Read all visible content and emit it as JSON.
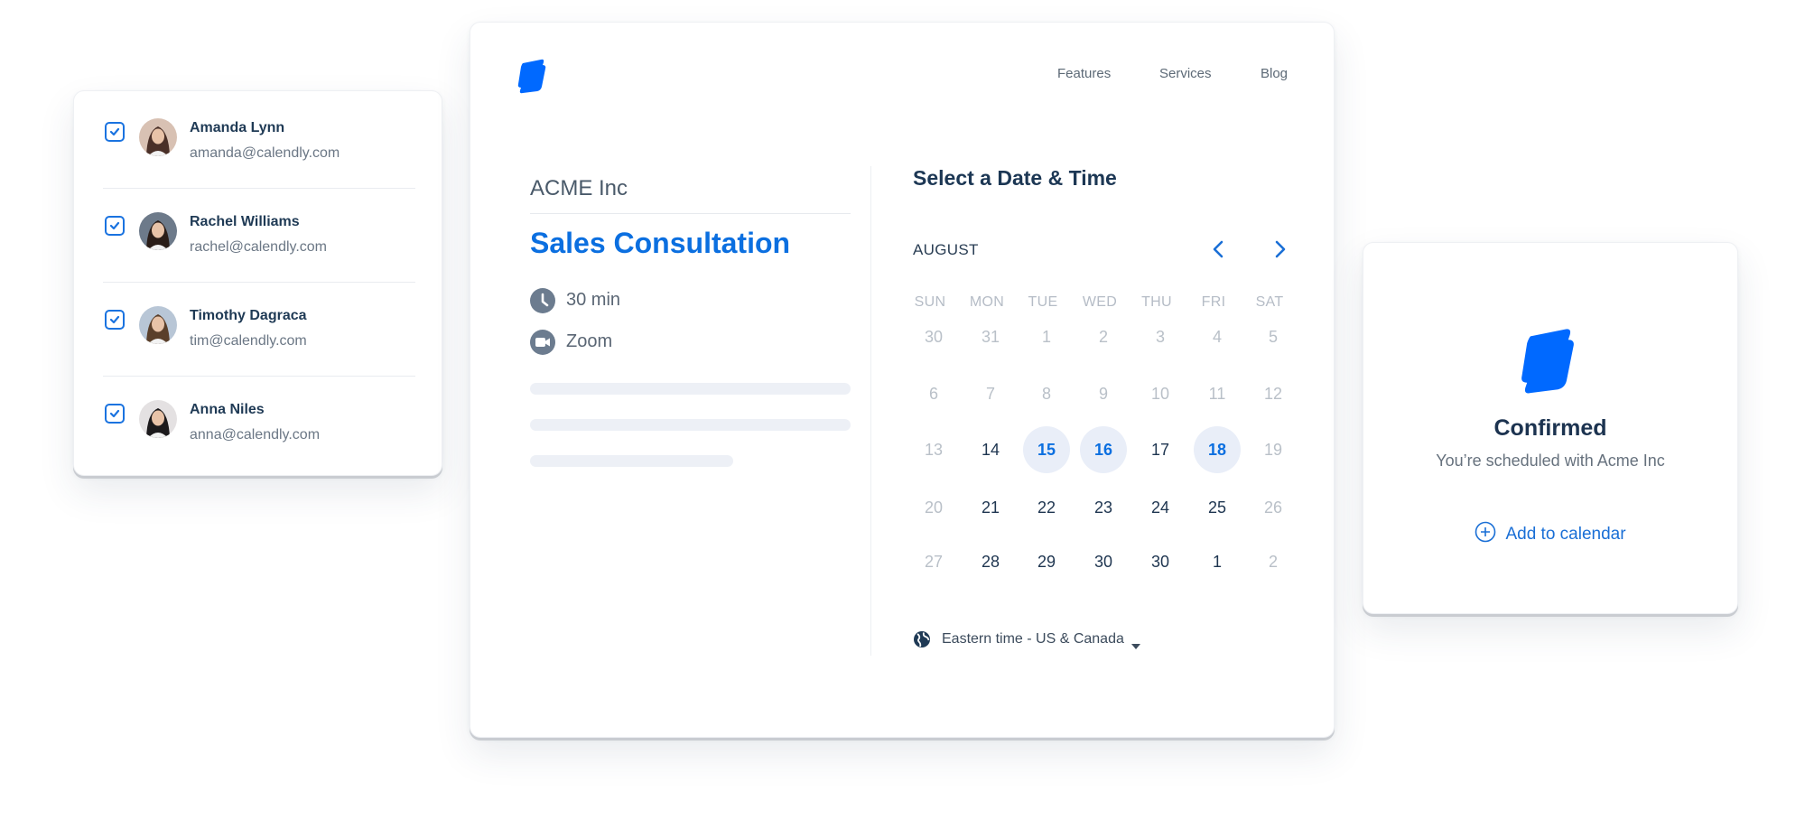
{
  "brand": {
    "accent": "#0069ff",
    "accent_text": "#0b6fe0"
  },
  "attendees": [
    {
      "name": "Amanda Lynn",
      "email": "amanda@calendly.com",
      "checked": true
    },
    {
      "name": "Rachel Williams",
      "email": "rachel@calendly.com",
      "checked": true
    },
    {
      "name": "Timothy Dagraca",
      "email": "tim@calendly.com",
      "checked": true
    },
    {
      "name": "Anna Niles",
      "email": "anna@calendly.com",
      "checked": true
    }
  ],
  "booking": {
    "nav": [
      {
        "label": "Features"
      },
      {
        "label": "Services"
      },
      {
        "label": "Blog"
      }
    ],
    "company": "ACME Inc",
    "event_title": "Sales Consultation",
    "details": [
      {
        "icon": "clock-icon",
        "text": "30 min"
      },
      {
        "icon": "video-camera-icon",
        "text": "Zoom"
      }
    ],
    "calendar": {
      "heading": "Select a Date & Time",
      "month": "AUGUST",
      "prev_icon": "chevron-left-icon",
      "next_icon": "chevron-right-icon",
      "weekdays": [
        "SUN",
        "MON",
        "TUE",
        "WED",
        "THU",
        "FRI",
        "SAT"
      ],
      "weeks": [
        [
          {
            "d": "30",
            "s": "muted"
          },
          {
            "d": "31",
            "s": "muted"
          },
          {
            "d": "1",
            "s": "muted"
          },
          {
            "d": "2",
            "s": "muted"
          },
          {
            "d": "3",
            "s": "muted"
          },
          {
            "d": "4",
            "s": "muted"
          },
          {
            "d": "5",
            "s": "muted"
          }
        ],
        [
          {
            "d": "6",
            "s": "muted"
          },
          {
            "d": "7",
            "s": "muted"
          },
          {
            "d": "8",
            "s": "muted"
          },
          {
            "d": "9",
            "s": "muted"
          },
          {
            "d": "10",
            "s": "muted"
          },
          {
            "d": "11",
            "s": "muted"
          },
          {
            "d": "12",
            "s": "muted"
          }
        ],
        [
          {
            "d": "13",
            "s": "muted"
          },
          {
            "d": "14",
            "s": "active"
          },
          {
            "d": "15",
            "s": "avail"
          },
          {
            "d": "16",
            "s": "avail"
          },
          {
            "d": "17",
            "s": "active"
          },
          {
            "d": "18",
            "s": "avail"
          },
          {
            "d": "19",
            "s": "muted"
          }
        ],
        [
          {
            "d": "20",
            "s": "muted"
          },
          {
            "d": "21",
            "s": "active"
          },
          {
            "d": "22",
            "s": "active"
          },
          {
            "d": "23",
            "s": "active"
          },
          {
            "d": "24",
            "s": "active"
          },
          {
            "d": "25",
            "s": "active"
          },
          {
            "d": "26",
            "s": "muted"
          }
        ],
        [
          {
            "d": "27",
            "s": "muted"
          },
          {
            "d": "28",
            "s": "active"
          },
          {
            "d": "29",
            "s": "active"
          },
          {
            "d": "30",
            "s": "active"
          },
          {
            "d": "30",
            "s": "active"
          },
          {
            "d": "1",
            "s": "active"
          },
          {
            "d": "2",
            "s": "muted"
          }
        ]
      ],
      "timezone": "Eastern time - US & Canada"
    }
  },
  "confirmed": {
    "title": "Confirmed",
    "subtitle": "You’re scheduled with Acme Inc",
    "add_to_calendar": "Add to calendar"
  }
}
